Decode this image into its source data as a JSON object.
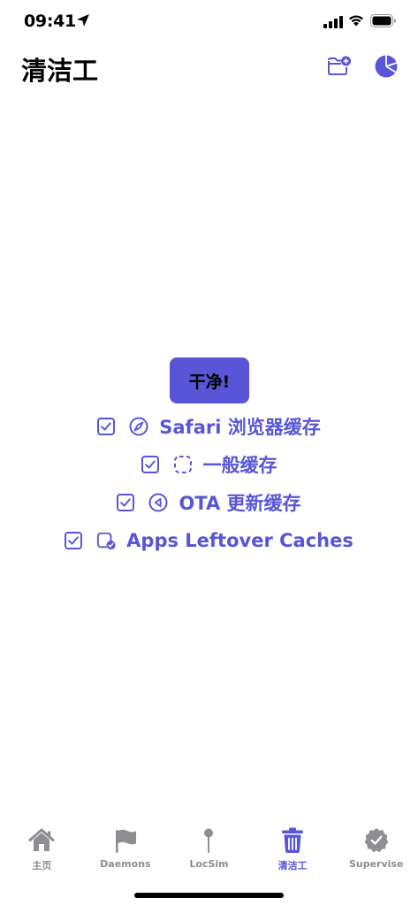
{
  "status_bar": {
    "time": "09:41"
  },
  "header": {
    "title": "清洁工"
  },
  "main": {
    "clean_button_label": "干净!",
    "options": [
      {
        "label": "Safari 浏览器缓存",
        "checked": true,
        "icon": "compass-icon"
      },
      {
        "label": "一般缓存",
        "checked": true,
        "icon": "dashed-square-icon"
      },
      {
        "label": "OTA 更新缓存",
        "checked": true,
        "icon": "arrow-left-circle-icon"
      },
      {
        "label": "Apps Leftover Caches",
        "checked": true,
        "icon": "app-badge-check-icon"
      }
    ]
  },
  "tab_bar": {
    "tabs": [
      {
        "label": "主页",
        "icon": "house-icon",
        "active": false
      },
      {
        "label": "Daemons",
        "icon": "flag-icon",
        "active": false
      },
      {
        "label": "LocSim",
        "icon": "pin-icon",
        "active": false
      },
      {
        "label": "清洁工",
        "icon": "trash-icon",
        "active": true
      },
      {
        "label": "Supervise",
        "icon": "checkmark-seal-icon",
        "active": false
      }
    ]
  },
  "colors": {
    "accent": "#5856d6",
    "inactive": "#8e8e93"
  }
}
